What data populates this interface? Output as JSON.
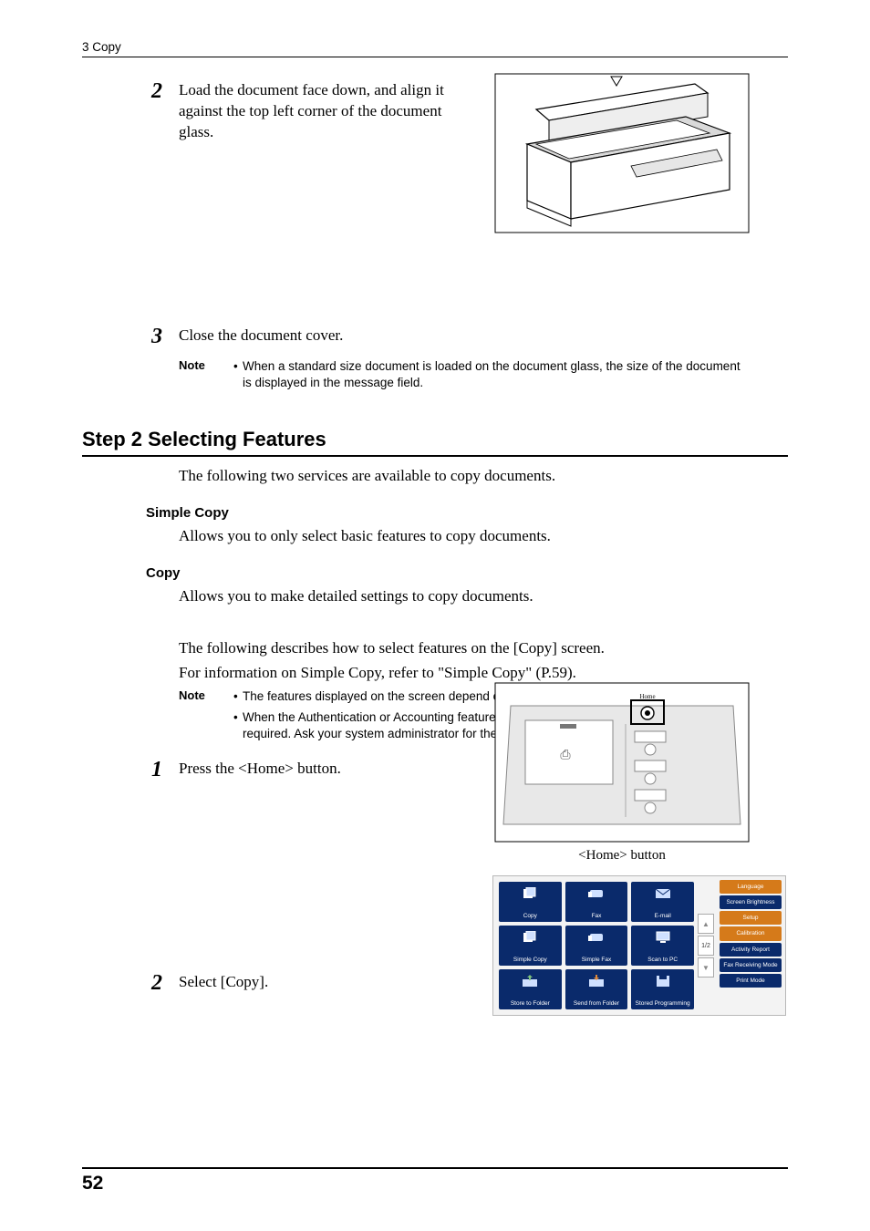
{
  "header": {
    "running": "3 Copy"
  },
  "footer": {
    "page_number": "52"
  },
  "step2_load": {
    "num": "2",
    "text": "Load the document face down, and align it against the top left corner of the document glass."
  },
  "step3_close": {
    "num": "3",
    "text": "Close the document cover."
  },
  "note1": {
    "label": "Note",
    "bullets": [
      "When a standard size document is loaded on the document glass, the size of the document is displayed in the message field."
    ]
  },
  "h2": "Step 2 Selecting Features",
  "intro": "The following two services are available to copy documents.",
  "simple_copy_h": "Simple Copy",
  "simple_copy_p": "Allows you to only select basic features to copy documents.",
  "copy_h": "Copy",
  "copy_p": "Allows you to make detailed settings to copy documents.",
  "following_p": "The following describes how to select features on the [Copy] screen.",
  "forinfo_p": "For information on Simple Copy, refer to \"Simple Copy\" (P.59).",
  "note2": {
    "label": "Note",
    "bullets": [
      "The features displayed on the screen depend on the configuration of your machine.",
      "When the Authentication or Accounting feature is enabled, a user ID and passcode may be required. Ask your system administrator for the user ID and passcode."
    ]
  },
  "step1_home": {
    "num": "1",
    "text": "Press the <Home> button."
  },
  "home_caption": "<Home> button",
  "step2_select": {
    "num": "2",
    "text": "Select [Copy]."
  },
  "screen": {
    "tiles": [
      "Copy",
      "Fax",
      "E-mail",
      "Simple Copy",
      "Simple Fax",
      "Scan to PC",
      "Store to Folder",
      "Send from Folder",
      "Stored Programming"
    ],
    "page_indicator": "1/2",
    "side": [
      "Language",
      "Screen Brightness",
      "Setup",
      "Calibration",
      "Activity Report",
      "Fax Receiving Mode",
      "Print Mode"
    ]
  }
}
